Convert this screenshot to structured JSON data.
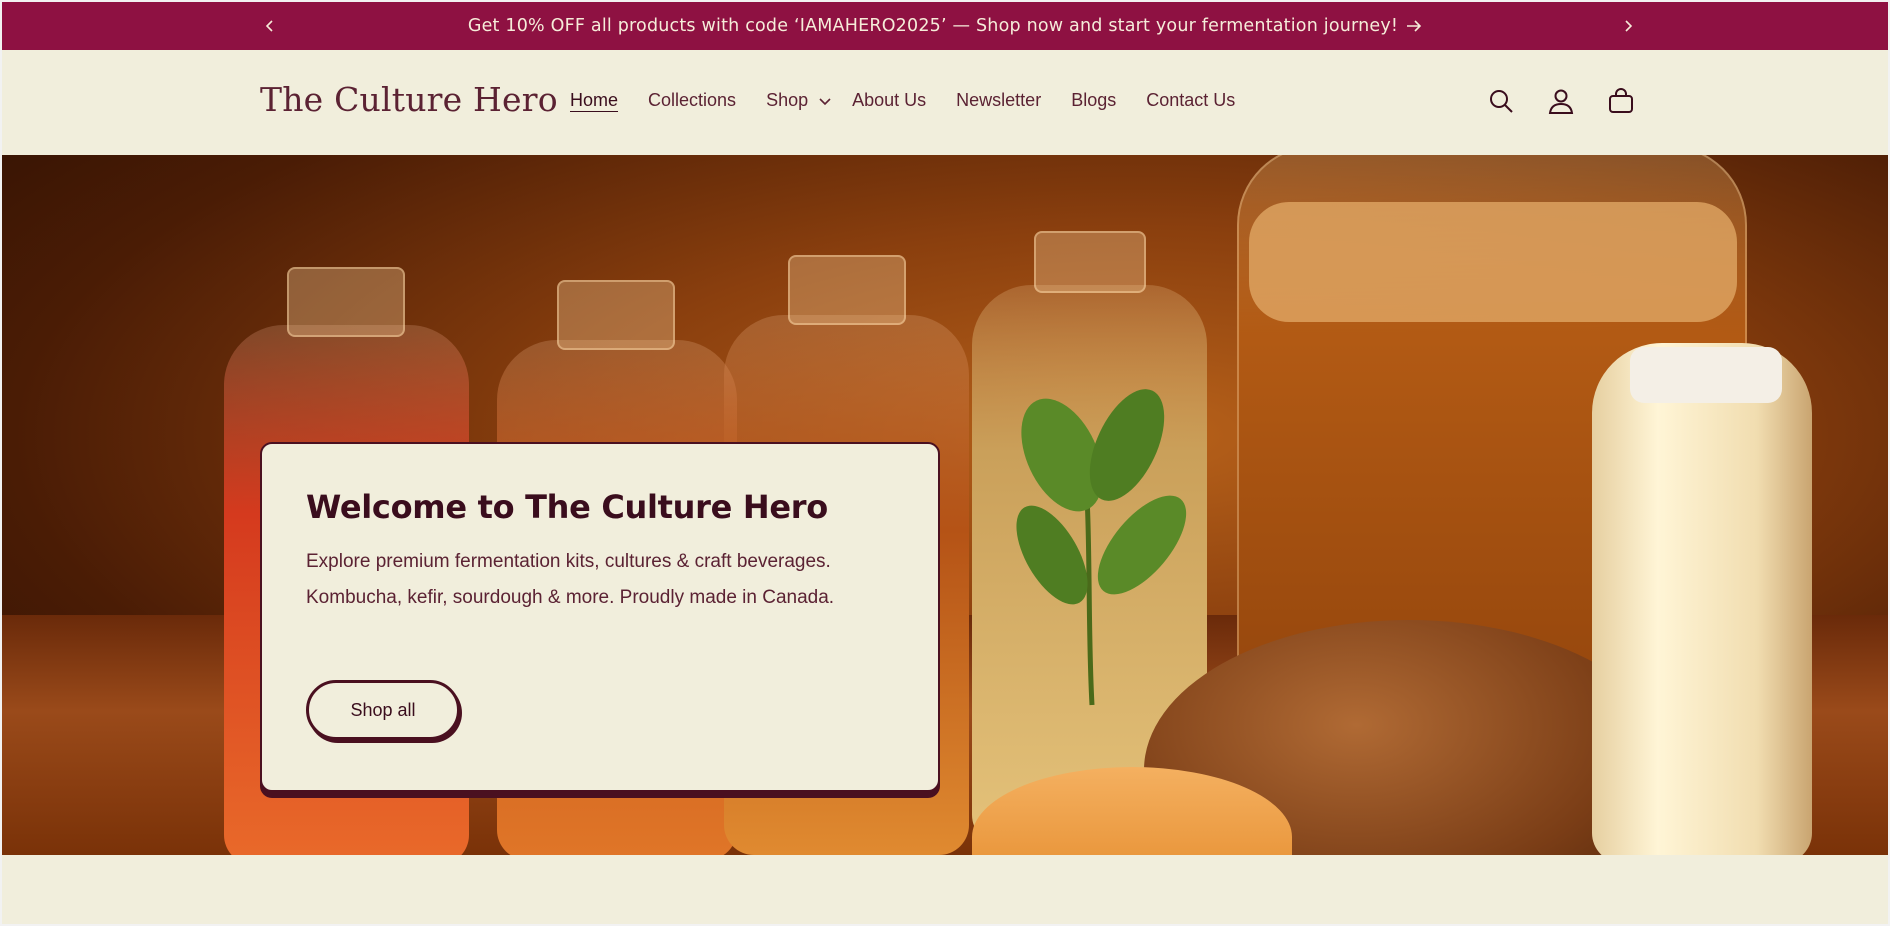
{
  "announcement": {
    "message": "Get 10% OFF all products with code ‘IAMAHERO2025’ — Shop now and start your fermentation journey!",
    "prev_icon": "chevron-left-icon",
    "next_icon": "chevron-right-icon",
    "arrow_icon": "arrow-right-icon",
    "background": "#8e1142"
  },
  "header": {
    "logo": "The Culture Hero",
    "nav": [
      {
        "label": "Home",
        "active": true
      },
      {
        "label": "Collections"
      },
      {
        "label": "Shop",
        "has_dropdown": true
      },
      {
        "label": "About Us"
      },
      {
        "label": "Newsletter"
      },
      {
        "label": "Blogs"
      },
      {
        "label": "Contact Us"
      }
    ],
    "icons": [
      "search-icon",
      "account-icon",
      "cart-icon"
    ]
  },
  "hero": {
    "title": "Welcome to The Culture Hero",
    "description": "Explore premium fermentation kits, cultures & craft beverages. Kombucha, kefir, sourdough & more. Proudly made in Canada.",
    "button": "Shop all"
  },
  "colors": {
    "accent": "#8e1142",
    "cream": "#f1eedc",
    "dark": "#3a0d1d"
  }
}
